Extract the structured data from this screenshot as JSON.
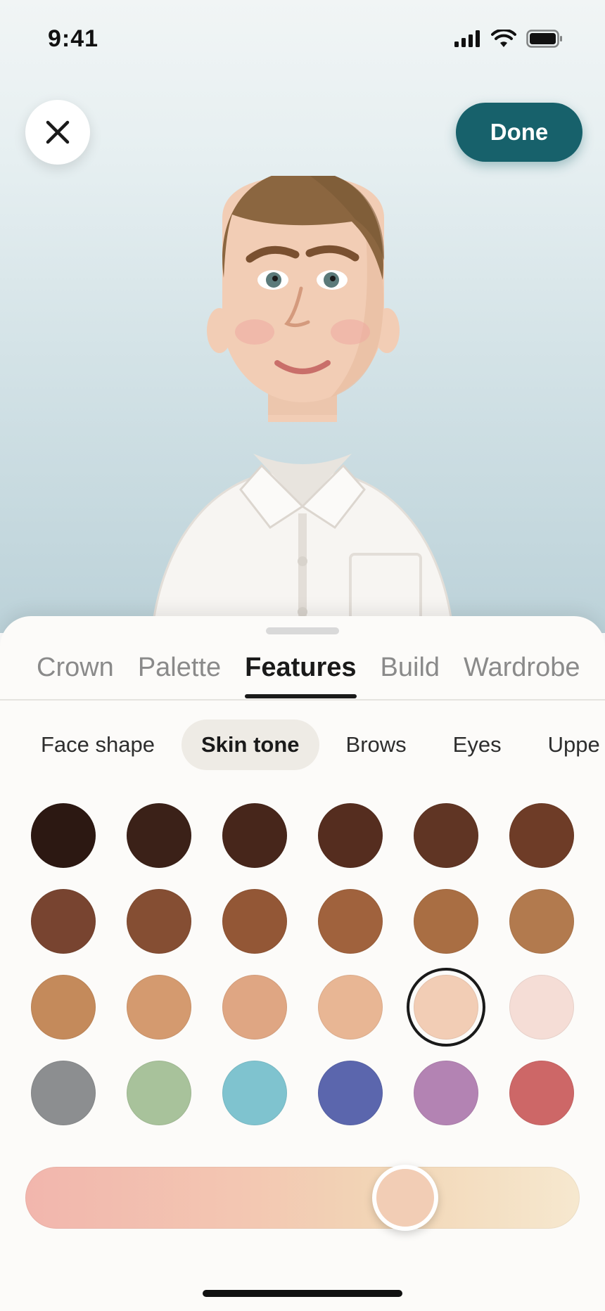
{
  "status_bar": {
    "time": "9:41",
    "icons": [
      "cellular-signal-icon",
      "wifi-icon",
      "battery-icon"
    ]
  },
  "header": {
    "close_icon": "close-icon",
    "done_label": "Done",
    "done_color": "#17616b"
  },
  "avatar": {
    "skin_color": "#f2cdb5",
    "hair_color": "#8b6640",
    "shirt_color": "#f7f5f2"
  },
  "tabs": [
    {
      "label": "Crown",
      "active": false
    },
    {
      "label": "Palette",
      "active": false
    },
    {
      "label": "Features",
      "active": true
    },
    {
      "label": "Build",
      "active": false
    },
    {
      "label": "Wardrobe",
      "active": false
    }
  ],
  "chips": [
    {
      "label": "Face shape",
      "active": false
    },
    {
      "label": "Skin tone",
      "active": true
    },
    {
      "label": "Brows",
      "active": false
    },
    {
      "label": "Eyes",
      "active": false
    },
    {
      "label": "Uppe",
      "active": false
    }
  ],
  "swatches": [
    "#2c1812",
    "#3b2118",
    "#47261b",
    "#552d1f",
    "#603524",
    "#6e3c27",
    "#784430",
    "#854e33",
    "#935736",
    "#a0623d",
    "#a96e43",
    "#b27a4e",
    "#c48a5b",
    "#d49a6f",
    "#dfa683",
    "#e8b694",
    "#f2cdb5",
    "#f5ddd6",
    "#8c8e90",
    "#a8c29b",
    "#7fc3cf",
    "#5b66ad",
    "#b383b3",
    "#cd6767"
  ],
  "selected_swatch_index": 16,
  "slider": {
    "value_fraction": 0.68,
    "thumb_color": "#f2cdb5"
  }
}
